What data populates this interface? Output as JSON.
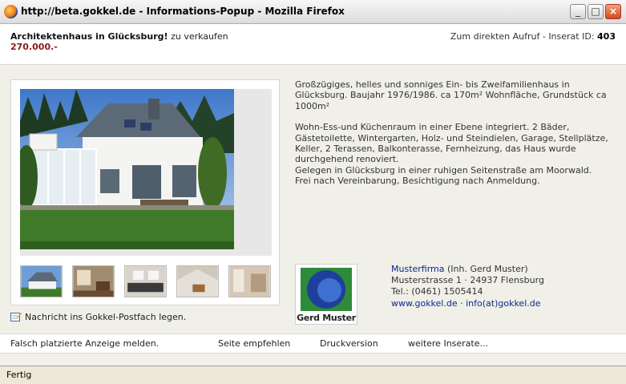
{
  "window": {
    "title": "http://beta.gokkel.de - Informations-Popup - Mozilla Firefox",
    "minimize_label": "_",
    "maximize_label": "□",
    "close_label": "×"
  },
  "listing": {
    "title_bold": "Architektenhaus in Glücksburg!",
    "title_suffix": " zu verkaufen",
    "price": "270.000.-",
    "direct_access_label": "Zum direkten Aufruf - Inserat ID: ",
    "inserat_id": "403"
  },
  "description": {
    "para1": "Großzügiges, helles und sonniges Ein- bis Zweifamilienhaus in Glücksburg. Baujahr 1976/1986. ca 170m² Wohnfläche, Grundstück ca 1000m²",
    "para2": "Wohn-Ess-und Küchenraum in einer Ebene integriert. 2 Bäder, Gästetoilette, Wintergarten, Holz- und Steindielen, Garage, Stellplätze, Keller, 2 Terassen, Balkonterasse, Fernheizung, das Haus wurde durchgehend renoviert.",
    "para3": "Gelegen in Glücksburg in einer ruhigen Seitenstraße am Moorwald.",
    "para4": "Frei nach Vereinbarung, Besichtigung nach Anmeldung."
  },
  "company": {
    "logo_text": "Gerd Muster",
    "name": "Musterfirma",
    "owner": " (Inh. Gerd Muster)",
    "address": "Musterstrasse 1 · 24937 Flensburg",
    "phone": "Tel.: (0461) 1505414",
    "website": "www.gokkel.de",
    "separator": " · ",
    "email": "info(at)gokkel.de"
  },
  "message_link": "Nachricht ins Gokkel-Postfach legen.",
  "footer": {
    "report": "Falsch platzierte Anzeige melden.",
    "recommend": "Seite empfehlen",
    "print": "Druckversion",
    "more": "weitere Inserate..."
  },
  "status": "Fertig",
  "colors": {
    "price": "#8b1a1a",
    "link": "#0b2a8a",
    "logo_green": "#2e8b3a",
    "logo_blue": "#1f3f9c"
  },
  "icons": [
    "firefox-icon",
    "house-photo",
    "interior-thumbnail",
    "pencil-note-icon",
    "company-logo"
  ]
}
